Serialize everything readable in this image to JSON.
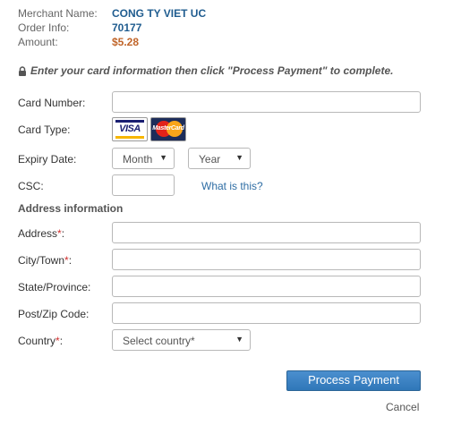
{
  "merchant": {
    "merchant_name_label": "Merchant Name:",
    "merchant_name_value": "CONG TY VIET UC",
    "order_info_label": "Order Info:",
    "order_info_value": "70177",
    "amount_label": "Amount:",
    "amount_value": "$5.28"
  },
  "instruction": {
    "icon": "lock-icon",
    "text": "Enter your card information then click \"Process Payment\" to complete."
  },
  "card": {
    "number_label": "Card Number:",
    "number_value": "",
    "type_label": "Card Type:",
    "type_logos": [
      "visa-logo",
      "mastercard-logo"
    ],
    "visa_text": "VISA",
    "mastercard_text": "MasterCard",
    "expiry_label": "Expiry Date:",
    "expiry_month_selected": "Month",
    "expiry_year_selected": "Year",
    "csc_label": "CSC:",
    "csc_value": "",
    "csc_help_link": "What is this?"
  },
  "address": {
    "heading": "Address information",
    "address_label": "Address",
    "city_label": "City/Town",
    "state_label": "State/Province:",
    "zip_label": "Post/Zip Code:",
    "country_label": "Country",
    "country_selected": "Select country*",
    "required_marker": "*",
    "colon": ":"
  },
  "actions": {
    "submit_label": "Process Payment",
    "cancel_label": "Cancel"
  },
  "colors": {
    "accent": "#2f77b8",
    "merchant_value": "#1f5c8f",
    "amount_value": "#c0652a",
    "required": "#d0302f"
  }
}
